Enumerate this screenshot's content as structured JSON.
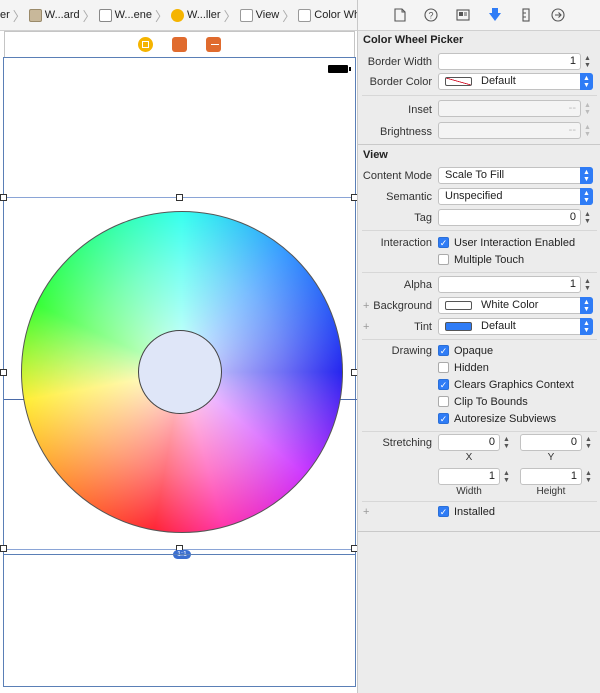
{
  "breadcrumb": {
    "items": [
      {
        "label": "er",
        "icon": "none"
      },
      {
        "label": "W...ard",
        "icon": "storyboard-file-icon"
      },
      {
        "label": "W...ene",
        "icon": "scene-icon"
      },
      {
        "label": "W...ller",
        "icon": "view-controller-icon"
      },
      {
        "label": "View",
        "icon": "view-icon"
      },
      {
        "label": "Color Wheel",
        "icon": "view-icon"
      }
    ]
  },
  "inspector_tabs": [
    "file-inspector-icon",
    "quick-help-icon",
    "identity-inspector-icon",
    "attributes-inspector-icon",
    "size-inspector-icon",
    "connections-inspector-icon"
  ],
  "canvas": {
    "scene_icons": [
      "view-controller-icon",
      "first-responder-icon",
      "exit-icon"
    ],
    "aspect_badge": "1:1"
  },
  "color_wheel_picker": {
    "title": "Color Wheel Picker",
    "border_width_label": "Border Width",
    "border_width": "1",
    "border_color_label": "Border Color",
    "border_color": "Default",
    "inset_label": "Inset",
    "inset_placeholder": "--",
    "brightness_label": "Brightness",
    "brightness_placeholder": "--"
  },
  "view": {
    "title": "View",
    "content_mode_label": "Content Mode",
    "content_mode": "Scale To Fill",
    "semantic_label": "Semantic",
    "semantic": "Unspecified",
    "tag_label": "Tag",
    "tag": "0",
    "interaction_label": "Interaction",
    "user_interaction_enabled": {
      "label": "User Interaction Enabled",
      "checked": true
    },
    "multiple_touch": {
      "label": "Multiple Touch",
      "checked": false
    },
    "alpha_label": "Alpha",
    "alpha": "1",
    "background_label": "Background",
    "background": "White Color",
    "tint_label": "Tint",
    "tint": "Default",
    "drawing_label": "Drawing",
    "opaque": {
      "label": "Opaque",
      "checked": true
    },
    "hidden": {
      "label": "Hidden",
      "checked": false
    },
    "clears_graphics_context": {
      "label": "Clears Graphics Context",
      "checked": true
    },
    "clip_to_bounds": {
      "label": "Clip To Bounds",
      "checked": false
    },
    "autoresize_subviews": {
      "label": "Autoresize Subviews",
      "checked": true
    },
    "stretching_label": "Stretching",
    "stretch_x": "0",
    "stretch_x_label": "X",
    "stretch_y": "0",
    "stretch_y_label": "Y",
    "stretch_width": "1",
    "stretch_width_label": "Width",
    "stretch_height": "1",
    "stretch_height_label": "Height",
    "installed": {
      "label": "Installed",
      "checked": true
    }
  },
  "colors": {
    "accent": "#2f7cf6",
    "tint_swatch": "#2f7cf6",
    "background_swatch": "#ffffff",
    "selection": "#5a7fb6"
  }
}
